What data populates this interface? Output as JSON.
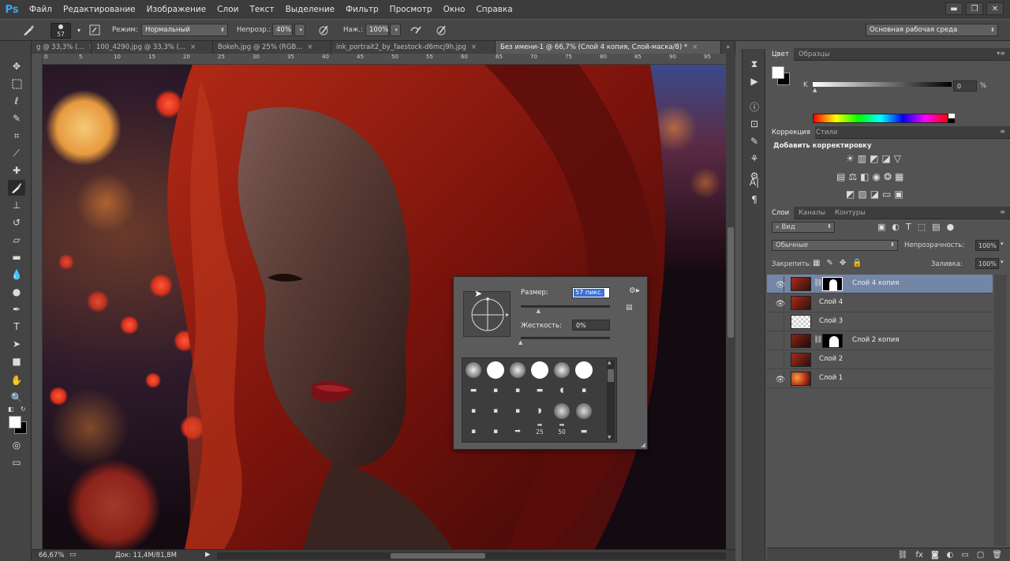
{
  "app": {
    "logo": "Ps"
  },
  "menu": [
    "Файл",
    "Редактирование",
    "Изображение",
    "Слои",
    "Текст",
    "Выделение",
    "Фильтр",
    "Просмотр",
    "Окно",
    "Справка"
  ],
  "window_controls": {
    "minimize": "▬",
    "restore": "❐",
    "close": "✕"
  },
  "options": {
    "brush_size": "57",
    "mode_label": "Режим:",
    "mode_value": "Нормальный",
    "opacity_label": "Непрозр.:",
    "opacity_value": "40%",
    "flow_label": "Наж.:",
    "flow_value": "100%",
    "workspace": "Основная рабочая среда"
  },
  "tabs": [
    {
      "label": "g @ 33,3% (..."
    },
    {
      "label": "100_4290.jpg @ 33,3% (..."
    },
    {
      "label": "Bokeh.jpg @ 25% (RGB..."
    },
    {
      "label": "ink_portrait2_by_faestock-d6mcj9h.jpg"
    },
    {
      "label": "Без имени-1 @ 66,7% (Слой 4 копия, Слой-маска/8) *"
    }
  ],
  "tab_close": "×",
  "tab_overflow": "»",
  "ruler_numbers": [
    "0",
    "5",
    "10",
    "15",
    "20",
    "25",
    "30",
    "35",
    "40",
    "45",
    "50",
    "55",
    "60",
    "65",
    "70",
    "75",
    "80",
    "85",
    "90",
    "95"
  ],
  "status": {
    "zoom": "66,67%",
    "doc": "Док: 11,4M/81,8M"
  },
  "panels": {
    "color": {
      "tabs": [
        "Цвет",
        "Образцы"
      ],
      "channel": "K",
      "value": "0",
      "unit": "%"
    },
    "adjust": {
      "tabs": [
        "Коррекция",
        "Стили"
      ],
      "heading": "Добавить корректировку"
    },
    "layers": {
      "tabs": [
        "Слои",
        "Каналы",
        "Контуры"
      ],
      "filter": "Вид",
      "blend": "Обычные",
      "opacity_label": "Непрозрачность:",
      "opacity_value": "100%",
      "lock_label": "Закрепить:",
      "fill_label": "Заливка:",
      "fill_value": "100%",
      "items": [
        {
          "name": "Слой 4 копия",
          "visible": true,
          "mask": true,
          "selected": true
        },
        {
          "name": "Слой 4",
          "visible": true,
          "mask": false,
          "selected": false
        },
        {
          "name": "Слой 3",
          "visible": false,
          "mask": false,
          "selected": false
        },
        {
          "name": "Слой 2 копия",
          "visible": false,
          "mask": true,
          "selected": false
        },
        {
          "name": "Слой 2",
          "visible": false,
          "mask": false,
          "selected": false
        },
        {
          "name": "Слой 1",
          "visible": true,
          "mask": false,
          "selected": false
        }
      ]
    }
  },
  "brush_popup": {
    "size_label": "Размер:",
    "size_value": "57 пикс.",
    "hardness_label": "Жесткость:",
    "hardness_value": "0%",
    "size_slider": 0.2,
    "hardness_slider": 0.0,
    "preset_labels": [
      "25",
      "50"
    ]
  },
  "colors": {
    "accent": "#31a8ff",
    "selected_layer": "#7386a6",
    "bg": "#535353"
  }
}
